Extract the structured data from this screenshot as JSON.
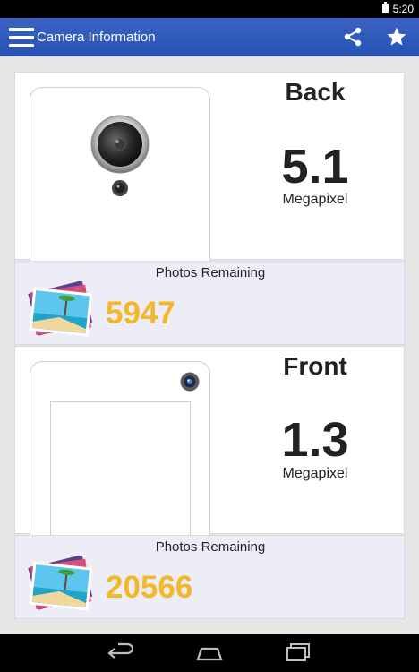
{
  "status_bar": {
    "time": "5:20"
  },
  "app_bar": {
    "title": "Camera Information",
    "icons": [
      "menu-icon",
      "share-icon",
      "star-icon"
    ]
  },
  "cameras": [
    {
      "label": "Back",
      "megapixels": "5.1",
      "unit": "Megapixel",
      "photos_label": "Photos Remaining",
      "photos_remaining": "5947"
    },
    {
      "label": "Front",
      "megapixels": "1.3",
      "unit": "Megapixel",
      "photos_label": "Photos Remaining",
      "photos_remaining": "20566"
    }
  ],
  "nav_bar": {
    "icons": [
      "back-icon",
      "home-icon",
      "recent-apps-icon"
    ]
  },
  "colors": {
    "app_bar": "#2f5bbd",
    "photos_count": "#f4b72a",
    "photos_card": "#ededf8"
  }
}
